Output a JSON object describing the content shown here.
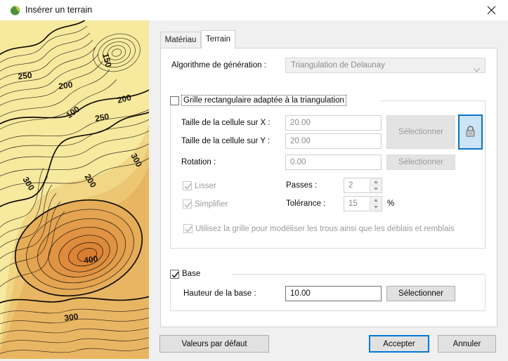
{
  "window": {
    "title": "Insérer un terrain",
    "icon": "terrain-sphere-icon",
    "close_icon": "close-icon"
  },
  "tabs": [
    {
      "label": "Matériau",
      "active": false
    },
    {
      "label": "Terrain",
      "active": true
    }
  ],
  "form": {
    "algorithm_label": "Algorithme de génération :",
    "algorithm_value": "Triangulation de Delaunay",
    "grid_group": {
      "checkbox_label": "Grille rectangulaire adaptée à la triangulation",
      "checked": false,
      "cell_x_label": "Taille de la cellule sur X :",
      "cell_x_value": "20.00",
      "cell_y_label": "Taille de la cellule sur Y :",
      "cell_y_value": "20.00",
      "cell_select_label": "Sélectionner",
      "lock_icon": "lock-icon",
      "rotation_label": "Rotation :",
      "rotation_value": "0.00",
      "rotation_select_label": "Sélectionner",
      "smooth_label": "Lisser",
      "smooth_checked": true,
      "passes_label": "Passes :",
      "passes_value": "2",
      "simplify_label": "Simplifier",
      "simplify_checked": true,
      "tolerance_label": "Tolérance :",
      "tolerance_value": "15",
      "tolerance_unit": "%",
      "holes_label": "Utilisez la grille pour modéliser les trous ainsi que les déblais et remblais",
      "holes_checked": true
    },
    "base_group": {
      "checkbox_label": "Base",
      "checked": true,
      "height_label": "Hauteur de la base :",
      "height_value": "10.00",
      "select_label": "Sélectionner"
    }
  },
  "footer": {
    "defaults_label": "Valeurs par défaut",
    "accept_label": "Accepter",
    "cancel_label": "Annuler"
  },
  "backdrop": {
    "kind": "topographic-contour-map",
    "contour_labels": [
      "250",
      "200",
      "150",
      "100",
      "250",
      "200",
      "300",
      "200",
      "300",
      "400",
      "300"
    ]
  },
  "colors": {
    "accent": "#0078d7",
    "surface": "#f0f0f0",
    "panel": "#ffffff",
    "disabled_text": "#9b9b9b"
  }
}
